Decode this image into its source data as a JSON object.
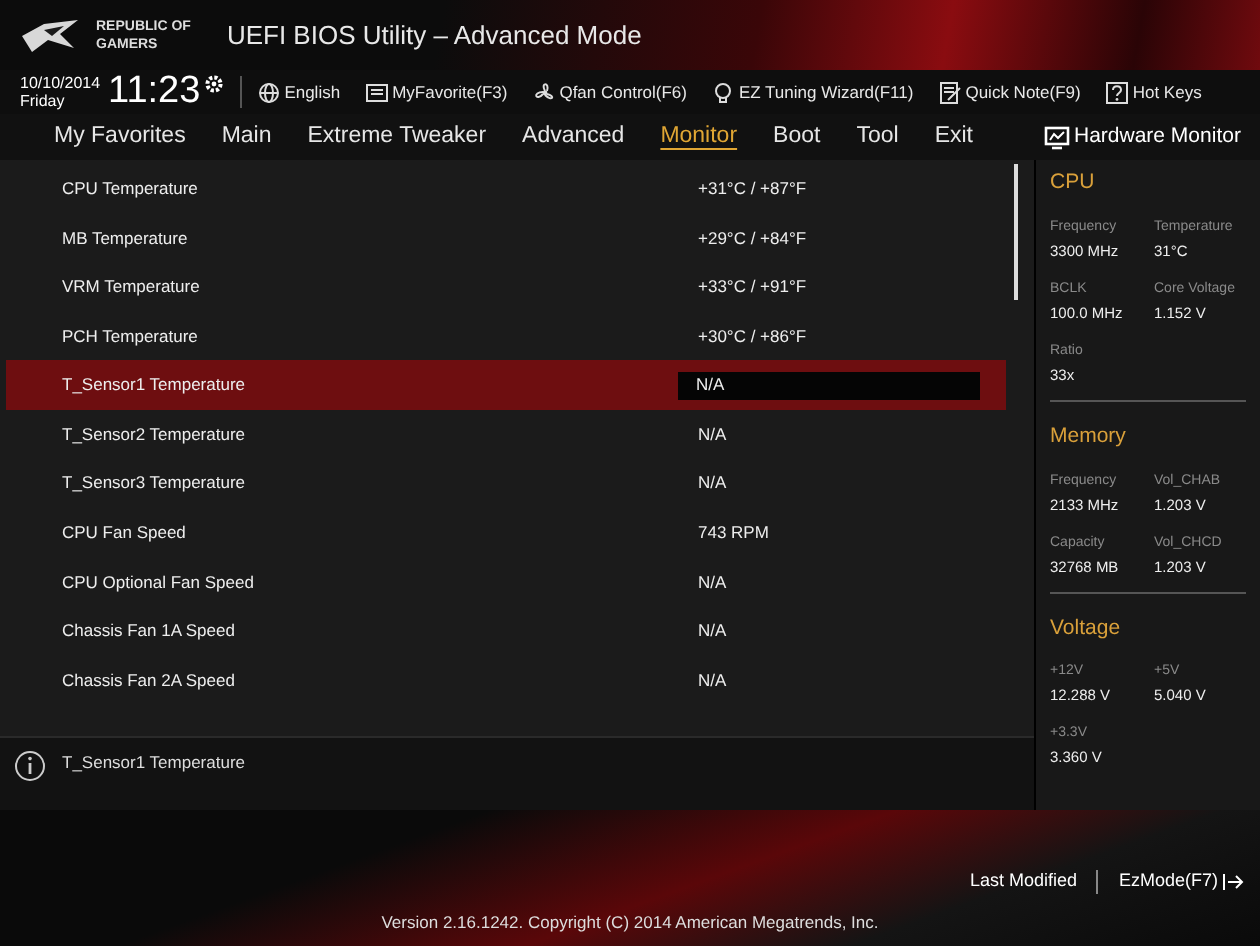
{
  "header": {
    "brand": [
      "REPUBLIC OF",
      "GAMERS"
    ],
    "title": "UEFI BIOS Utility – Advanced Mode"
  },
  "toolbar": {
    "date": "10/10/2014",
    "day": "Friday",
    "time": "11:23",
    "items": [
      {
        "kind": "globe",
        "label": "English"
      },
      {
        "kind": "favorite",
        "label": "MyFavorite(F3)"
      },
      {
        "kind": "fan",
        "label": "Qfan Control(F6)"
      },
      {
        "kind": "bulb",
        "label": "EZ Tuning Wizard(F11)"
      },
      {
        "kind": "note",
        "label": "Quick Note(F9)"
      },
      {
        "kind": "help",
        "label": "Hot Keys"
      }
    ]
  },
  "tabs": [
    {
      "label": "My Favorites",
      "selected": false
    },
    {
      "label": "Main",
      "selected": false
    },
    {
      "label": "Extreme Tweaker",
      "selected": false
    },
    {
      "label": "Advanced",
      "selected": false
    },
    {
      "label": "Monitor",
      "selected": true
    },
    {
      "label": "Boot",
      "selected": false
    },
    {
      "label": "Tool",
      "selected": false
    },
    {
      "label": "Exit",
      "selected": false
    }
  ],
  "items": [
    {
      "label": "CPU Temperature",
      "value": "+31°C / +87°F",
      "selected": false
    },
    {
      "label": "MB Temperature",
      "value": "+29°C / +84°F",
      "selected": false
    },
    {
      "label": "VRM Temperature",
      "value": "+33°C / +91°F",
      "selected": false
    },
    {
      "label": "PCH Temperature",
      "value": "+30°C / +86°F",
      "selected": false
    },
    {
      "label": "T_Sensor1 Temperature",
      "value": "N/A",
      "selected": true
    },
    {
      "label": "T_Sensor2 Temperature",
      "value": "N/A",
      "selected": false
    },
    {
      "label": "T_Sensor3 Temperature",
      "value": "N/A",
      "selected": false
    },
    {
      "label": "CPU Fan Speed",
      "value": "743 RPM",
      "selected": false
    },
    {
      "label": "CPU Optional Fan Speed",
      "value": "N/A",
      "selected": false
    },
    {
      "label": "Chassis Fan 1A Speed",
      "value": "N/A",
      "selected": false
    },
    {
      "label": "Chassis Fan 2A Speed",
      "value": "N/A",
      "selected": false
    }
  ],
  "help_text": "T_Sensor1 Temperature",
  "hardware_monitor": {
    "title": "Hardware Monitor",
    "sections": [
      {
        "title": "CPU",
        "fields": [
          {
            "label": "Frequency",
            "value": "3300 MHz"
          },
          {
            "label": "Temperature",
            "value": "31°C"
          },
          {
            "label": "BCLK",
            "value": "100.0 MHz"
          },
          {
            "label": "Core Voltage",
            "value": "1.152 V"
          },
          {
            "label": "Ratio",
            "value": "33x"
          }
        ]
      },
      {
        "title": "Memory",
        "fields": [
          {
            "label": "Frequency",
            "value": "2133 MHz"
          },
          {
            "label": "Vol_CHAB",
            "value": "1.203 V"
          },
          {
            "label": "Capacity",
            "value": "32768 MB"
          },
          {
            "label": "Vol_CHCD",
            "value": "1.203 V"
          }
        ]
      },
      {
        "title": "Voltage",
        "fields": [
          {
            "label": "+12V",
            "value": "12.288 V"
          },
          {
            "label": "+5V",
            "value": "5.040 V"
          },
          {
            "label": "+3.3V",
            "value": "3.360 V"
          }
        ]
      }
    ]
  },
  "footer": {
    "last_modified": "Last Modified",
    "ez_mode": "EzMode(F7)",
    "version": "Version 2.16.1242. Copyright (C) 2014 American Megatrends, Inc."
  }
}
